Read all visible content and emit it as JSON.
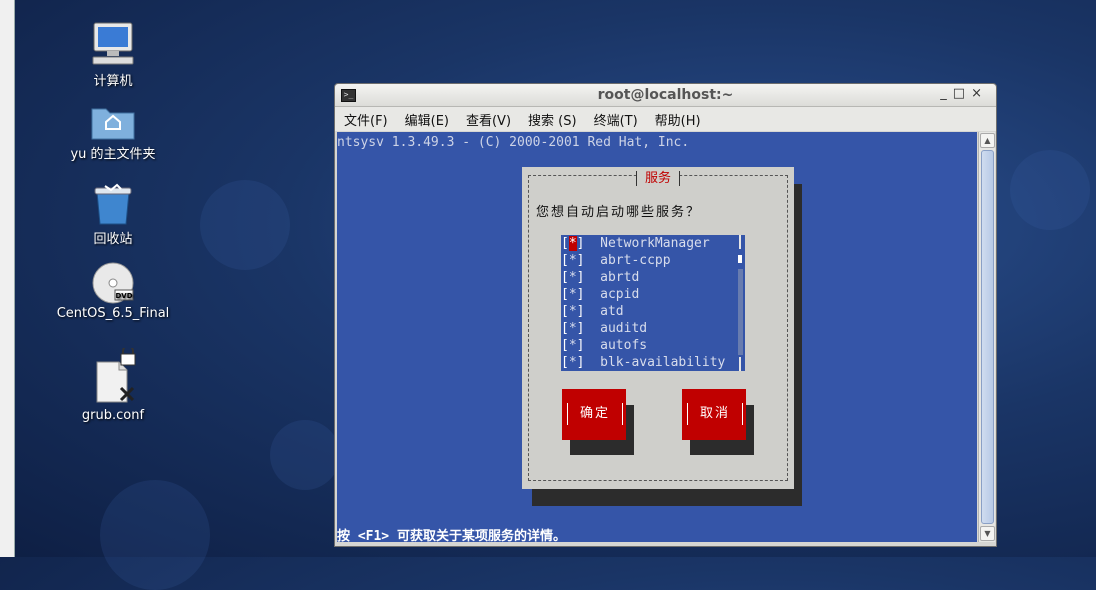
{
  "desktop": {
    "icons": [
      {
        "label": "计算机",
        "icon": "computer-icon"
      },
      {
        "label": "yu 的主文件夹",
        "icon": "home-folder-icon"
      },
      {
        "label": "回收站",
        "icon": "trash-icon"
      },
      {
        "label": "CentOS_6.5_Final",
        "icon": "dvd-icon",
        "badge": "DVD"
      },
      {
        "label": "grub.conf",
        "icon": "locked-file-icon"
      }
    ]
  },
  "window": {
    "title": "root@localhost:~",
    "controls": [
      "_",
      "□",
      "×"
    ],
    "menu": [
      "文件(F)",
      "编辑(E)",
      "查看(V)",
      "搜索 (S)",
      "终端(T)",
      "帮助(H)"
    ]
  },
  "terminal": {
    "header_line": "ntsysv 1.3.49.3 - (C) 2000-2001 Red Hat, Inc.",
    "status_line": "按 <F1> 可获取关于某项服务的详情。"
  },
  "dialog": {
    "title": "服务",
    "prompt": "您想自动启动哪些服务？",
    "services": [
      {
        "name": "NetworkManager",
        "mark": "*"
      },
      {
        "name": "abrt-ccpp",
        "mark": "*"
      },
      {
        "name": "abrtd",
        "mark": "*"
      },
      {
        "name": "acpid",
        "mark": "*"
      },
      {
        "name": "atd",
        "mark": "*"
      },
      {
        "name": "auditd",
        "mark": "*"
      },
      {
        "name": "autofs",
        "mark": "*"
      },
      {
        "name": "blk-availability",
        "mark": "*"
      }
    ],
    "ok_label": "确定",
    "cancel_label": "取消"
  },
  "colors": {
    "terminal_bg": "#3555a8",
    "dialog_bg": "#cfcfcb",
    "accent_red": "#c00000"
  }
}
